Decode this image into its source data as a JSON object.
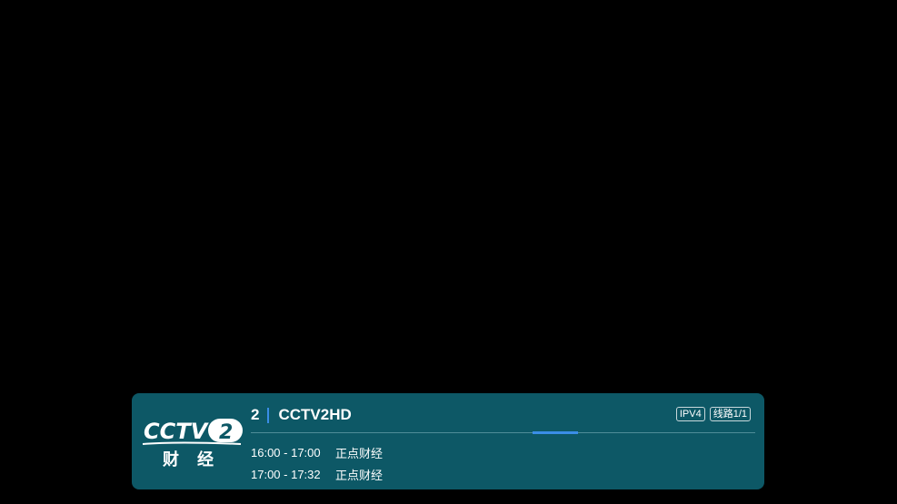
{
  "player": {
    "background": "#000000"
  },
  "info_panel": {
    "background": "#0d5866",
    "logo": {
      "brand": "CCTV",
      "number": "2",
      "subtitle": "财经"
    },
    "channel": {
      "number": "2",
      "name": "CCTV2HD"
    },
    "badges": [
      "IPV4",
      "线路1/1"
    ],
    "progress": {
      "value_fraction": 0.72,
      "color": "#3a8ee6"
    },
    "programs": [
      {
        "time": "16:00 - 17:00",
        "title": "正点财经"
      },
      {
        "time": "17:00 - 17:32",
        "title": "正点财经"
      }
    ]
  }
}
